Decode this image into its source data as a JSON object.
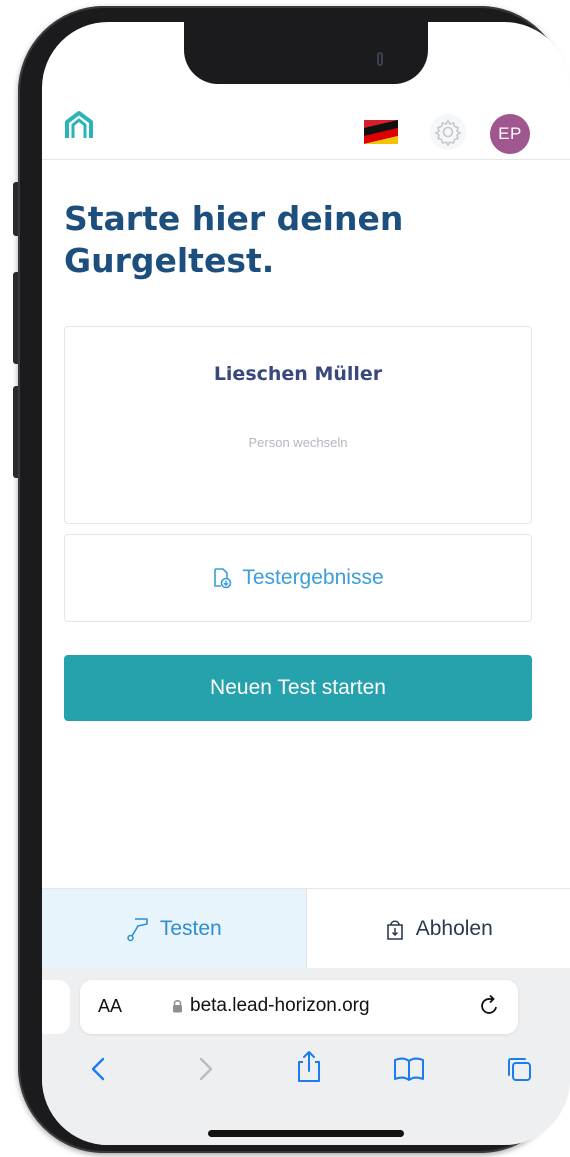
{
  "header": {
    "avatar_initials": "EP"
  },
  "page": {
    "title": "Starte hier deinen Gurgeltest."
  },
  "person_card": {
    "name": "Lieschen Müller",
    "switch_label": "Person wechseln"
  },
  "results_card": {
    "label": "Testergebnisse"
  },
  "primary_action": {
    "label": "Neuen Test starten"
  },
  "tabs": [
    {
      "label": "Testen",
      "icon": "gargle-tube-icon",
      "active": true
    },
    {
      "label": "Abholen",
      "icon": "pickup-bag-icon",
      "active": false
    }
  ],
  "browser": {
    "aa_label": "AA",
    "url": "beta.lead-horizon.org"
  },
  "colors": {
    "title": "#1d4f7e",
    "primary_button": "#25a2ab",
    "link": "#3a9ed8",
    "avatar": "#a0568f",
    "active_tab_bg": "#e8f4fc"
  }
}
